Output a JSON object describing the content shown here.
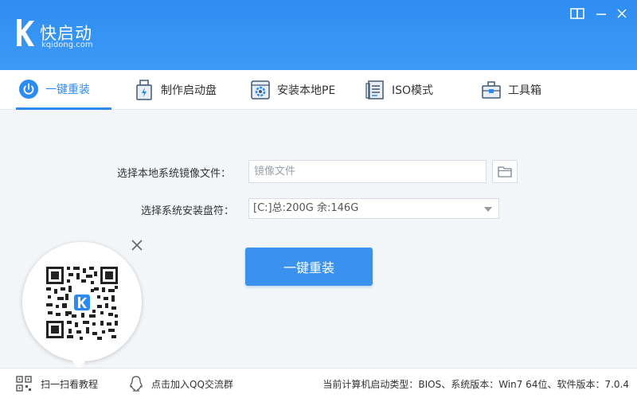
{
  "app": {
    "name": "快启动",
    "domain": "kqidong.com"
  },
  "colors": {
    "primary": "#2b8bf0",
    "titlebar": "#3a94f3",
    "button": "#3a92ee"
  },
  "window_controls": [
    {
      "icon": "book-icon"
    },
    {
      "icon": "minimize-icon"
    },
    {
      "icon": "close-icon"
    }
  ],
  "tabs": [
    {
      "label": "一键重装",
      "icon": "power-icon",
      "active": true
    },
    {
      "label": "制作启动盘",
      "icon": "usb-drive-icon",
      "active": false
    },
    {
      "label": "安装本地PE",
      "icon": "gear-disk-icon",
      "active": false
    },
    {
      "label": "ISO模式",
      "icon": "document-icon",
      "active": false
    },
    {
      "label": "工具箱",
      "icon": "toolbox-icon",
      "active": false
    }
  ],
  "form": {
    "image_label": "选择本地系统镜像文件：",
    "image_placeholder": "镜像文件",
    "image_value": "",
    "disk_label": "选择系统安装盘符：",
    "disk_selected": "[C:]总:200G 余:146G"
  },
  "primary_button": "一键重装",
  "footer": {
    "scan_label": "扫一扫看教程",
    "qq_label": "点击加入QQ交流群",
    "status": "当前计算机启动类型：BIOS、系统版本：Win7 64位、软件版本：7.0.4"
  }
}
